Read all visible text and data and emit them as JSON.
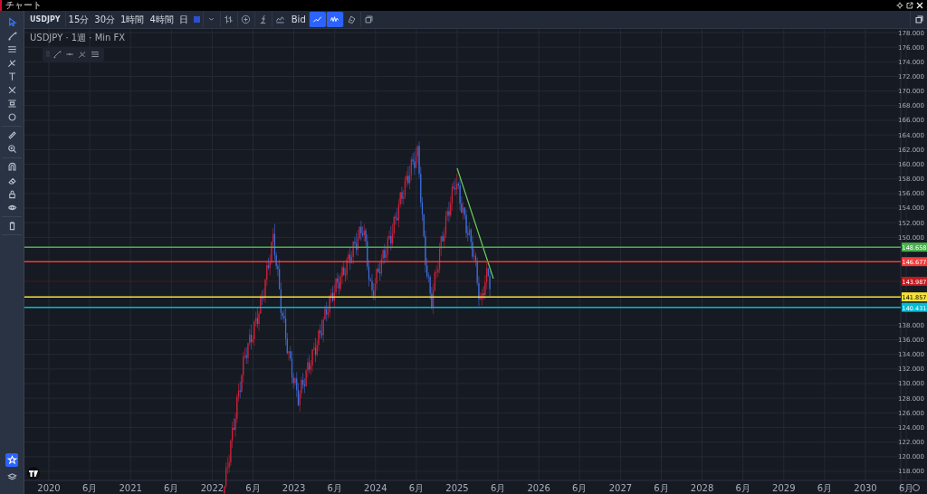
{
  "window": {
    "title": "チャート"
  },
  "toolbar": [
    {
      "kind": "symbol",
      "label": "USDJPY",
      "selected": false
    },
    {
      "kind": "interval",
      "label": "15分",
      "selected": false
    },
    {
      "kind": "interval",
      "label": "30分",
      "selected": false
    },
    {
      "kind": "interval",
      "label": "1時間",
      "selected": false
    },
    {
      "kind": "interval",
      "label": "4時間",
      "selected": false
    },
    {
      "kind": "interval",
      "label": "日",
      "selected": false
    },
    {
      "kind": "swatch",
      "selected": false
    },
    {
      "kind": "caret",
      "selected": false
    },
    {
      "kind": "candles",
      "selected": false
    },
    {
      "kind": "add",
      "selected": false
    },
    {
      "kind": "indicator",
      "selected": false
    },
    {
      "kind": "compare",
      "selected": false
    },
    {
      "kind": "interval",
      "label": "Bid",
      "selected": false
    },
    {
      "kind": "line-chart",
      "selected": true
    },
    {
      "kind": "wave",
      "selected": true
    },
    {
      "kind": "paint",
      "selected": false
    },
    {
      "kind": "layers",
      "selected": false
    }
  ],
  "left_toolbar": {
    "groups": [
      [
        {
          "kind": "cursor",
          "selected": true
        },
        {
          "kind": "trend-line",
          "selected": false
        },
        {
          "kind": "fib",
          "selected": false
        },
        {
          "kind": "pitchfork",
          "selected": false
        },
        {
          "kind": "text",
          "selected": false
        },
        {
          "kind": "pattern",
          "selected": false
        },
        {
          "kind": "range",
          "selected": false
        },
        {
          "kind": "circle",
          "selected": false
        }
      ],
      [
        {
          "kind": "ruler",
          "selected": false
        },
        {
          "kind": "zoom",
          "selected": false
        }
      ],
      [
        {
          "kind": "magnet",
          "selected": false
        },
        {
          "kind": "eraser",
          "selected": false
        },
        {
          "kind": "lock",
          "selected": false
        },
        {
          "kind": "eye",
          "selected": false
        }
      ],
      [
        {
          "kind": "trash",
          "selected": false
        }
      ]
    ],
    "bottom": [
      {
        "kind": "star",
        "selected": true
      },
      {
        "kind": "eye-layers",
        "selected": false
      }
    ]
  },
  "legend": "USDJPY · 1週 · Min FX",
  "floating_tools": [
    {
      "kind": "trend-line"
    },
    {
      "kind": "hline"
    },
    {
      "kind": "pitchfork"
    },
    {
      "kind": "fib"
    }
  ],
  "price_axis": [
    "178.000",
    "176.000",
    "174.000",
    "172.000",
    "170.000",
    "168.000",
    "166.000",
    "164.000",
    "162.000",
    "160.000",
    "158.000",
    "156.000",
    "154.000",
    "152.000",
    "150.000",
    "138.000",
    "136.000",
    "134.000",
    "132.000",
    "130.000",
    "128.000",
    "126.000",
    "124.000",
    "122.000",
    "120.000",
    "118.000"
  ],
  "price_lines": [
    {
      "label": "148.658",
      "color": "#4caf50",
      "kind": "line"
    },
    {
      "label": "146.677",
      "color": "#f23b3b",
      "kind": "line"
    },
    {
      "label": "143.987",
      "color": "#c2181f",
      "kind": "last"
    },
    {
      "label": "141.857",
      "color": "#f5e13a",
      "kind": "line"
    },
    {
      "label": "140.431",
      "color": "#00bcd4",
      "kind": "line"
    }
  ],
  "time_axis": [
    "2020",
    "6月",
    "2021",
    "6月",
    "2022",
    "6月",
    "2023",
    "6月",
    "2024",
    "6月",
    "2025",
    "6月",
    "2026",
    "6月",
    "2027",
    "6月",
    "2028",
    "6月",
    "2029",
    "6月",
    "2030",
    "6月"
  ]
}
